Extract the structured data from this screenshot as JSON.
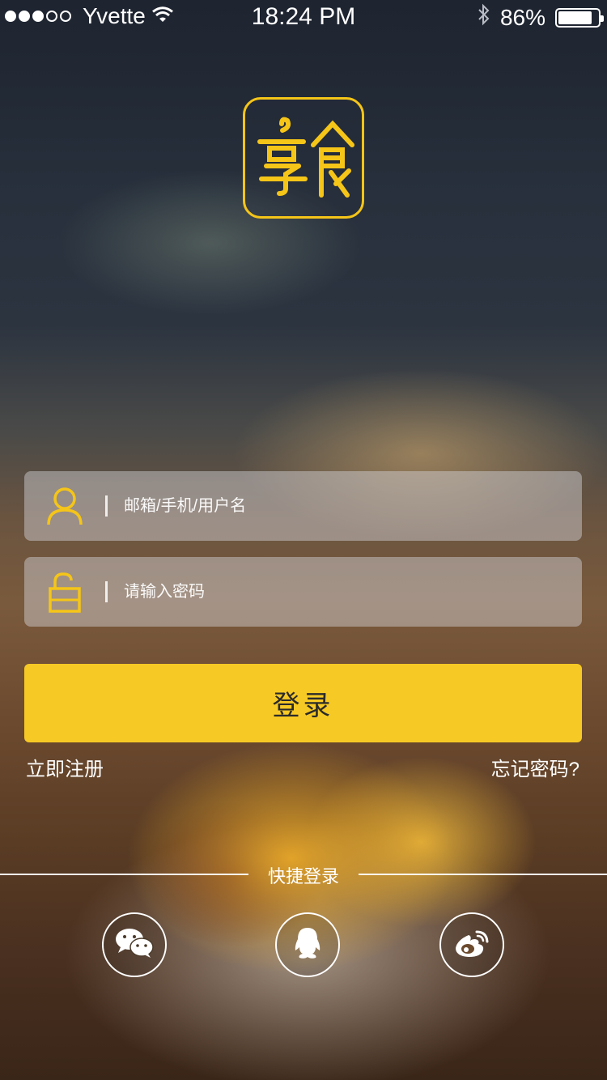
{
  "status_bar": {
    "signal_filled": 3,
    "signal_total": 5,
    "carrier": "Yvette",
    "wifi_icon": "wifi-icon",
    "time": "18:24 PM",
    "bluetooth_icon": "bluetooth-icon",
    "battery_percent": "86%",
    "battery_level": 0.86
  },
  "logo": {
    "text": "享食",
    "accent_color": "#f5c518"
  },
  "form": {
    "username_placeholder": "邮箱/手机/用户名",
    "username_icon": "user-icon",
    "password_placeholder": "请输入密码",
    "password_icon": "unlock-icon"
  },
  "login_button": "登录",
  "links": {
    "register": "立即注册",
    "forgot_password": "忘记密码?"
  },
  "quick_login": {
    "label": "快捷登录",
    "providers": [
      {
        "icon": "wechat-icon"
      },
      {
        "icon": "qq-icon"
      },
      {
        "icon": "weibo-icon"
      }
    ]
  },
  "colors": {
    "accent": "#f7c925",
    "button_text": "#2b2b2b"
  }
}
